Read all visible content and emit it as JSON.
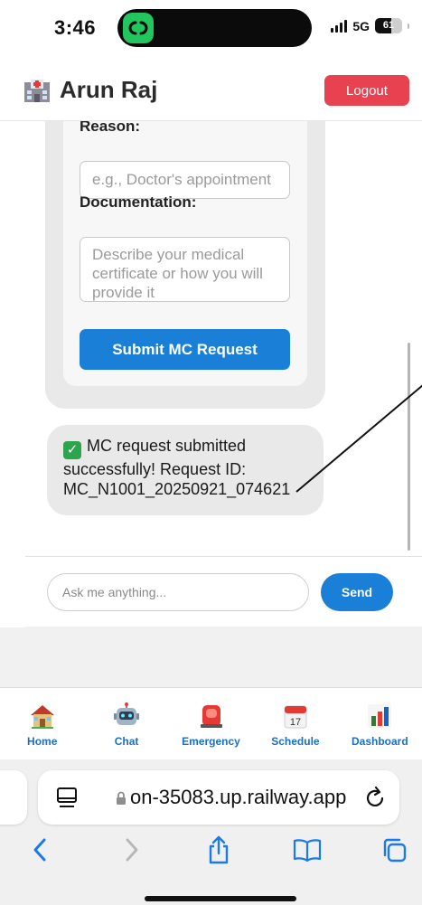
{
  "status_bar": {
    "time": "3:46",
    "network": "5G",
    "battery": "61",
    "battery_level": 0.61
  },
  "header": {
    "user_name": "Arun Raj",
    "logout_label": "Logout"
  },
  "mc_form": {
    "reason_label": "Reason:",
    "reason_placeholder": "e.g., Doctor's appointment",
    "documentation_label": "Documentation:",
    "documentation_placeholder": "Describe your medical certificate or how you will provide it",
    "submit_label": "Submit MC Request"
  },
  "chat": {
    "success_message": "MC request submitted successfully! Request ID: MC_N1001_20250921_074621",
    "input_placeholder": "Ask me anything...",
    "send_label": "Send"
  },
  "bottom_nav": {
    "items": [
      {
        "label": "Home",
        "icon": "house-icon"
      },
      {
        "label": "Chat",
        "icon": "robot-icon"
      },
      {
        "label": "Emergency",
        "icon": "siren-icon"
      },
      {
        "label": "Schedule",
        "icon": "calendar-icon"
      },
      {
        "label": "Dashboard",
        "icon": "bar-chart-icon"
      }
    ],
    "calendar_day": "17"
  },
  "browser": {
    "url": "on-35083.up.railway.app"
  },
  "colors": {
    "accent": "#1a7fd6",
    "logout": "#e8414f",
    "nav_label": "#1a6fc6"
  }
}
